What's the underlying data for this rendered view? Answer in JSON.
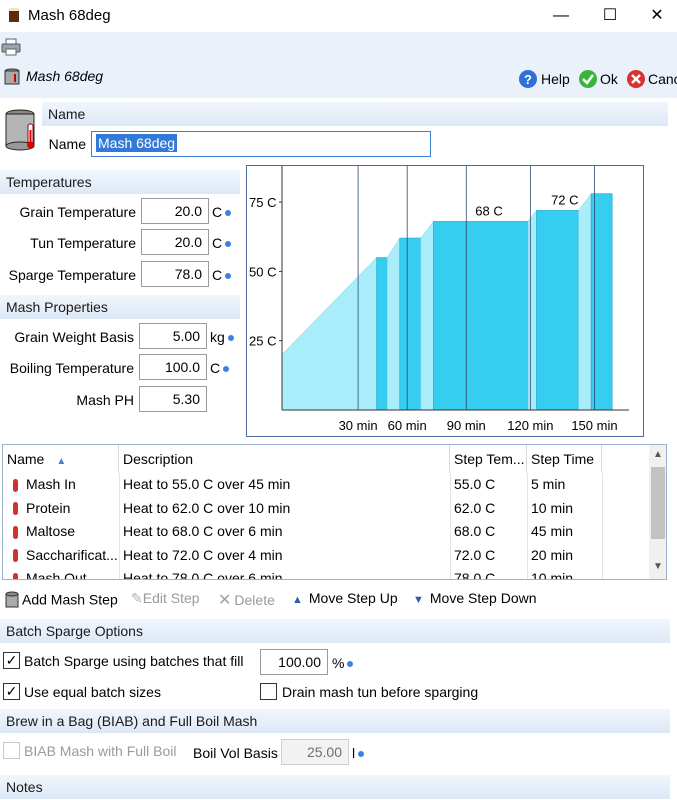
{
  "window": {
    "title": "Mash 68deg",
    "minimize": "—",
    "maximize": "☐",
    "close": "✕"
  },
  "header": {
    "mash_title": "Mash 68deg",
    "help_label": "Help",
    "ok_label": "Ok",
    "cancel_label": "Cancel"
  },
  "name_section": {
    "title": "Name",
    "name_label": "Name",
    "name_value": "Mash 68deg"
  },
  "temperatures": {
    "title": "Temperatures",
    "grain_label": "Grain Temperature",
    "grain_value": "20.0",
    "grain_unit": "C",
    "tun_label": "Tun Temperature",
    "tun_value": "20.0",
    "tun_unit": "C",
    "sparge_label": "Sparge Temperature",
    "sparge_value": "78.0",
    "sparge_unit": "C"
  },
  "mash_properties": {
    "title": "Mash Properties",
    "weight_label": "Grain Weight Basis",
    "weight_value": "5.00",
    "weight_unit": "kg",
    "boil_label": "Boiling Temperature",
    "boil_value": "100.0",
    "boil_unit": "C",
    "ph_label": "Mash PH",
    "ph_value": "5.30"
  },
  "chart_data": {
    "type": "area",
    "x_ticks": [
      "30 min",
      "60 min",
      "90 min",
      "120 min",
      "150 min"
    ],
    "x_tick_values": [
      30,
      60,
      90,
      120,
      150
    ],
    "y_ticks": [
      "25 C",
      "50 C",
      "75 C"
    ],
    "y_tick_values": [
      25,
      50,
      75
    ],
    "xlim": [
      0,
      165
    ],
    "ylim": [
      0,
      88
    ],
    "annotations": [
      {
        "text": "68 C",
        "x": 90,
        "y": 68
      },
      {
        "text": "72 C",
        "x": 127,
        "y": 72
      }
    ],
    "step_dividers": [
      30,
      60,
      90,
      120,
      150
    ],
    "profile": [
      [
        0,
        20
      ],
      [
        45,
        55
      ],
      [
        50,
        55
      ],
      [
        50,
        55
      ],
      [
        50,
        55
      ],
      [
        55,
        58
      ],
      [
        55,
        62
      ],
      [
        65,
        62
      ],
      [
        65,
        62
      ],
      [
        71,
        68
      ],
      [
        116,
        68
      ],
      [
        116,
        68
      ],
      [
        120,
        72
      ],
      [
        136,
        72
      ],
      [
        136,
        72
      ],
      [
        140,
        78
      ],
      [
        150,
        78
      ]
    ],
    "bars": [
      {
        "x0": 0,
        "x1": 45,
        "kind": "ramp",
        "y0": 20,
        "y1": 55
      },
      {
        "x0": 45,
        "x1": 50,
        "kind": "hold",
        "y": 55
      },
      {
        "x0": 50,
        "x1": 56,
        "kind": "ramp",
        "y0": 55,
        "y1": 62
      },
      {
        "x0": 56,
        "x1": 66,
        "kind": "hold",
        "y": 62
      },
      {
        "x0": 66,
        "x1": 72,
        "kind": "ramp",
        "y0": 62,
        "y1": 68
      },
      {
        "x0": 72,
        "x1": 117,
        "kind": "hold",
        "y": 68
      },
      {
        "x0": 117,
        "x1": 121,
        "kind": "ramp",
        "y0": 68,
        "y1": 72
      },
      {
        "x0": 121,
        "x1": 141,
        "kind": "hold",
        "y": 72
      },
      {
        "x0": 141,
        "x1": 147,
        "kind": "ramp",
        "y0": 72,
        "y1": 78
      },
      {
        "x0": 147,
        "x1": 157,
        "kind": "hold",
        "y": 78
      }
    ]
  },
  "steps_table": {
    "headers": [
      "Name",
      "Description",
      "Step Tem...",
      "Step Time"
    ],
    "rows": [
      {
        "name": "Mash In",
        "desc": "Heat to 55.0 C over 45 min",
        "temp": "55.0 C",
        "time": "5 min"
      },
      {
        "name": "Protein",
        "desc": "Heat to 62.0 C over 10 min",
        "temp": "62.0 C",
        "time": "10 min"
      },
      {
        "name": "Maltose",
        "desc": "Heat to 68.0 C over 6 min",
        "temp": "68.0 C",
        "time": "45 min"
      },
      {
        "name": "Saccharificat...",
        "desc": "Heat to 72.0 C over 4 min",
        "temp": "72.0 C",
        "time": "20 min"
      },
      {
        "name": "Mash Out",
        "desc": "Heat to 78.0 C over 6 min",
        "temp": "78.0 C",
        "time": "10 min"
      }
    ]
  },
  "step_buttons": {
    "add": "Add Mash Step",
    "edit": "Edit Step",
    "delete": "Delete",
    "up": "Move Step Up",
    "down": "Move Step Down"
  },
  "batch_sparge": {
    "title": "Batch Sparge Options",
    "fill_label": "Batch Sparge using batches that fill",
    "fill_value": "100.00",
    "fill_unit": "%",
    "equal_label": "Use equal batch sizes",
    "drain_label": "Drain mash tun before sparging"
  },
  "biab": {
    "title": "Brew in a Bag (BIAB) and Full Boil Mash",
    "biab_label": "BIAB Mash with Full Boil",
    "boil_vol_label": "Boil Vol Basis",
    "boil_vol_value": "25.00",
    "boil_vol_unit": "l"
  },
  "notes": {
    "title": "Notes"
  }
}
